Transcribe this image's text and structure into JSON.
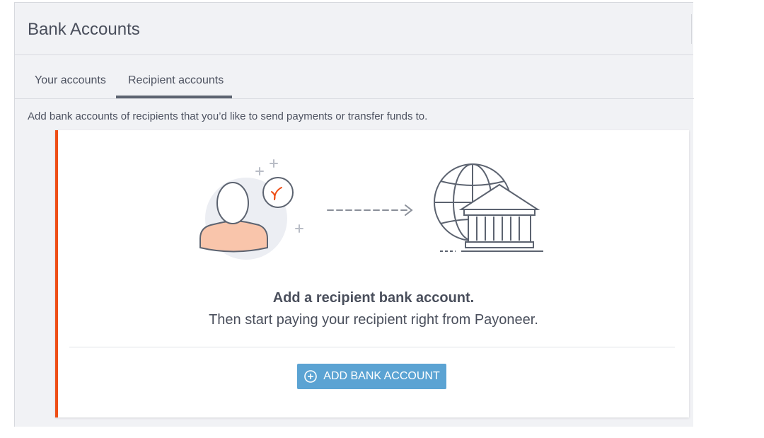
{
  "header": {
    "title": "Bank Accounts"
  },
  "tabs": [
    {
      "label": "Your accounts",
      "active": false
    },
    {
      "label": "Recipient accounts",
      "active": true
    }
  ],
  "description": "Add bank accounts of recipients that you’d like to send payments or transfer funds to.",
  "card": {
    "title": "Add a recipient bank account.",
    "subtitle": "Then start paying your recipient right from Payoneer.",
    "button_label": "ADD BANK ACCOUNT",
    "button_icon": "plus-circle-icon",
    "illustration_icons": [
      "person-icon",
      "clock-icon",
      "arrow-right-icon",
      "globe-icon",
      "bank-icon"
    ]
  },
  "colors": {
    "accent": "#ee4e16",
    "button": "#5ba3d3",
    "skin": "#f9c5ab",
    "text": "#4a4f5c"
  }
}
